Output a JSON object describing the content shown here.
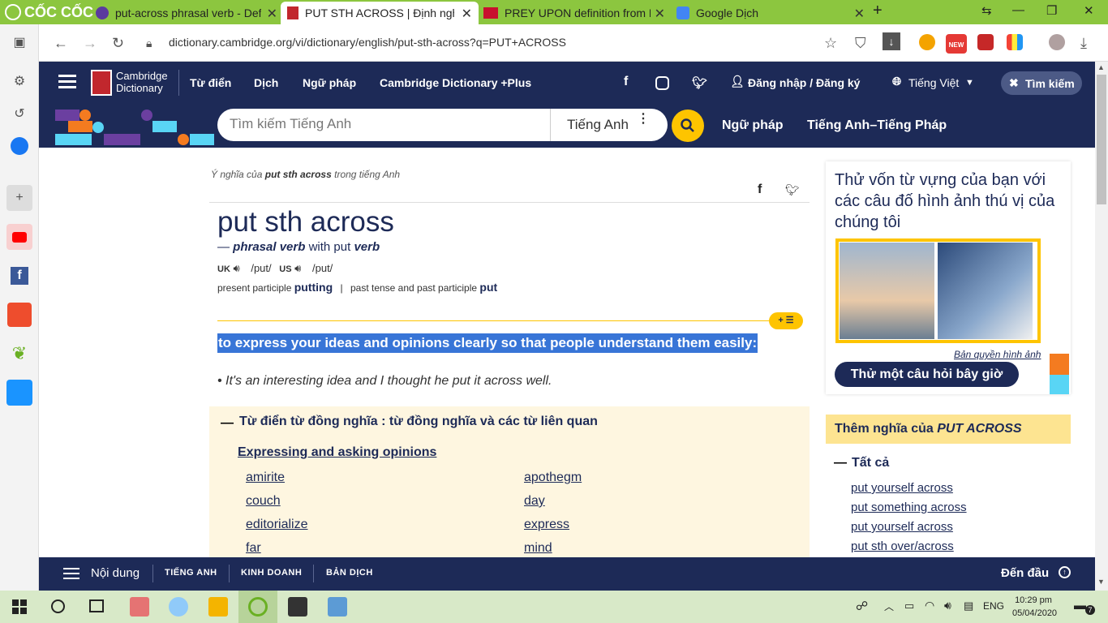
{
  "browser": {
    "logo_text": "CỐC CỐC",
    "tabs": [
      {
        "label": "put-across phrasal verb - Defi",
        "active": false
      },
      {
        "label": "PUT STH ACROSS | Định nghĩa",
        "active": true
      },
      {
        "label": "PREY UPON definition from M",
        "active": false
      },
      {
        "label": "Google Dịch",
        "active": false
      }
    ],
    "new_tab": "+",
    "url": "dictionary.cambridge.org/vi/dictionary/english/put-sth-across?q=PUT+ACROSS",
    "ext_new_badge": "NEW"
  },
  "header": {
    "logo_line1": "Cambridge",
    "logo_line2": "Dictionary",
    "menu": [
      "Từ điển",
      "Dịch",
      "Ngữ pháp",
      "Cambridge Dictionary +Plus"
    ],
    "login": "Đăng nhập / Đăng ký",
    "language": "Tiếng Việt",
    "search_label": "Tìm kiếm"
  },
  "search": {
    "placeholder": "Tìm kiếm Tiếng Anh",
    "dict": "Tiếng Anh",
    "links": [
      "Ngữ pháp",
      "Tiếng Anh–Tiếng Pháp"
    ]
  },
  "entry": {
    "meaning_of_prefix": "Ý nghĩa của",
    "meaning_of_word": "put sth across",
    "meaning_of_suffix": "trong tiếng Anh",
    "headword": "put sth across",
    "pos_dash": "—",
    "pos": "phrasal verb",
    "with": "with put",
    "with_pos": "verb",
    "uk_label": "UK",
    "us_label": "US",
    "uk_ipa": "/put/",
    "us_ipa": "/put/",
    "present_participle_label": "present participle",
    "present_participle": "putting",
    "past_label": "past tense and past participle",
    "past": "put",
    "definition": "to express your ideas and opinions clearly so that people understand them easily:",
    "example": "It's an interesting idea and I thought he put it across well.",
    "expand_badge": "+ ☰"
  },
  "thesaurus": {
    "title": "Từ điển từ đồng nghĩa : từ đồng nghĩa và các từ liên quan",
    "category": "Expressing and asking opinions",
    "col1": [
      "amirite",
      "couch",
      "editorialize",
      "far"
    ],
    "col2": [
      "apothegm",
      "day",
      "express",
      "mind"
    ]
  },
  "sidebar": {
    "quiz_text": "Thử vốn từ vựng của bạn với các câu đố hình ảnh thú vị của chúng tôi",
    "copyright": "Bản quyền hình ảnh",
    "quiz_button": "Thử một câu hỏi bây giờ",
    "more_label": "Thêm nghĩa của",
    "more_word": "PUT ACROSS",
    "all_label": "Tất cả",
    "links": [
      "put yourself across",
      "put something across",
      "put yourself across",
      "put sth over/across"
    ]
  },
  "bottom": {
    "contents": "Nội dung",
    "links": [
      "TIẾNG ANH",
      "KINH DOANH",
      "BẢN DỊCH"
    ],
    "to_top": "Đến đầu"
  },
  "taskbar": {
    "lang": "ENG",
    "time": "10:29 pm",
    "date": "05/04/2020",
    "notif_count": "7"
  },
  "colors": {
    "brand_navy": "#1d2a57",
    "accent_yellow": "#fec400",
    "browser_green": "#8cc63f",
    "highlight_blue": "#3875d7"
  }
}
